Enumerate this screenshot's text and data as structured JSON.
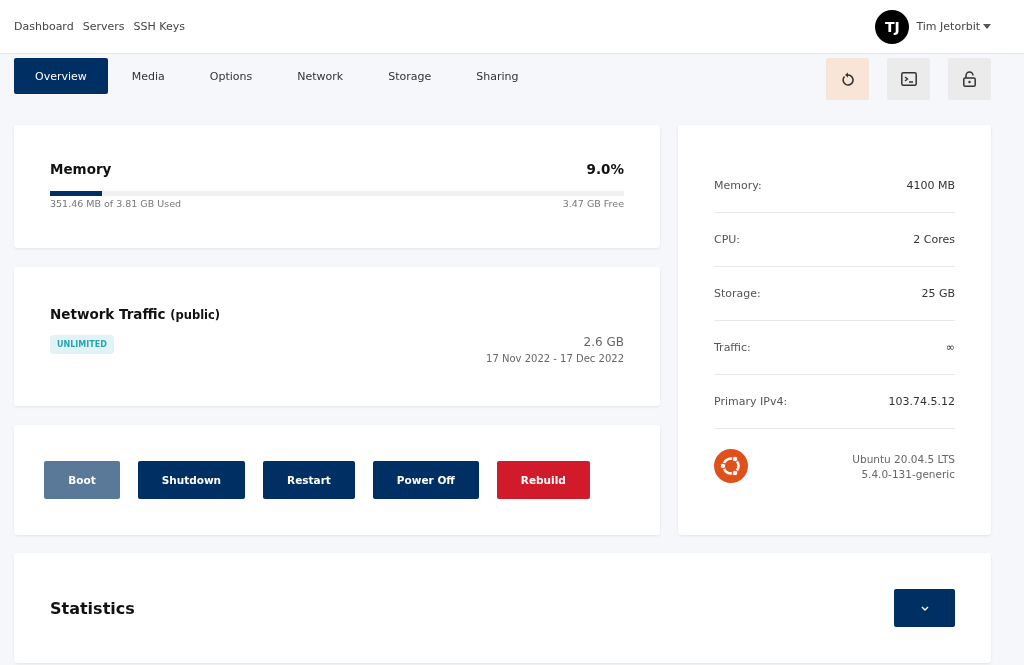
{
  "nav": {
    "links": [
      "Dashboard",
      "Servers",
      "SSH Keys"
    ],
    "user": {
      "initials": "TJ",
      "name": "Tim Jetorbit"
    }
  },
  "tabs": [
    {
      "label": "Overview",
      "selected": true
    },
    {
      "label": "Media",
      "selected": false
    },
    {
      "label": "Options",
      "selected": false
    },
    {
      "label": "Network",
      "selected": false
    },
    {
      "label": "Storage",
      "selected": false
    },
    {
      "label": "Sharing",
      "selected": false
    }
  ],
  "tools": [
    {
      "kind": "reset"
    },
    {
      "kind": "console"
    },
    {
      "kind": "lock"
    }
  ],
  "memory": {
    "title": "Memory",
    "percent": "9.0%",
    "level": 0.09,
    "used": "351.46 MB of 3.81 GB Used",
    "free": "3.47 GB Free"
  },
  "traffic": {
    "title": "Network Traffic",
    "qualifier": "(public)",
    "badge": "UNLIMITED",
    "amount": "2.6 GB",
    "period": "17 Nov 2022 - 17 Dec 2022"
  },
  "actions": [
    {
      "label": "Boot",
      "kind": "primary",
      "disabled": true
    },
    {
      "label": "Shutdown",
      "kind": "primary",
      "disabled": false
    },
    {
      "label": "Restart",
      "kind": "primary",
      "disabled": false
    },
    {
      "label": "Power Off",
      "kind": "primary",
      "disabled": false
    },
    {
      "label": "Rebuild",
      "kind": "danger",
      "disabled": false
    }
  ],
  "specs": [
    {
      "label": "Memory:",
      "value": "4100 MB"
    },
    {
      "label": "CPU:",
      "value": "2 Cores"
    },
    {
      "label": "Storage:",
      "value": "25 GB"
    },
    {
      "label": "Traffic:",
      "value": "∞"
    },
    {
      "label": "Primary IPv4:",
      "value": "103.74.5.12"
    }
  ],
  "os": {
    "name": "Ubuntu 20.04.5 LTS",
    "kernel": "5.4.0-131-generic"
  },
  "statistics": {
    "title": "Statistics"
  }
}
